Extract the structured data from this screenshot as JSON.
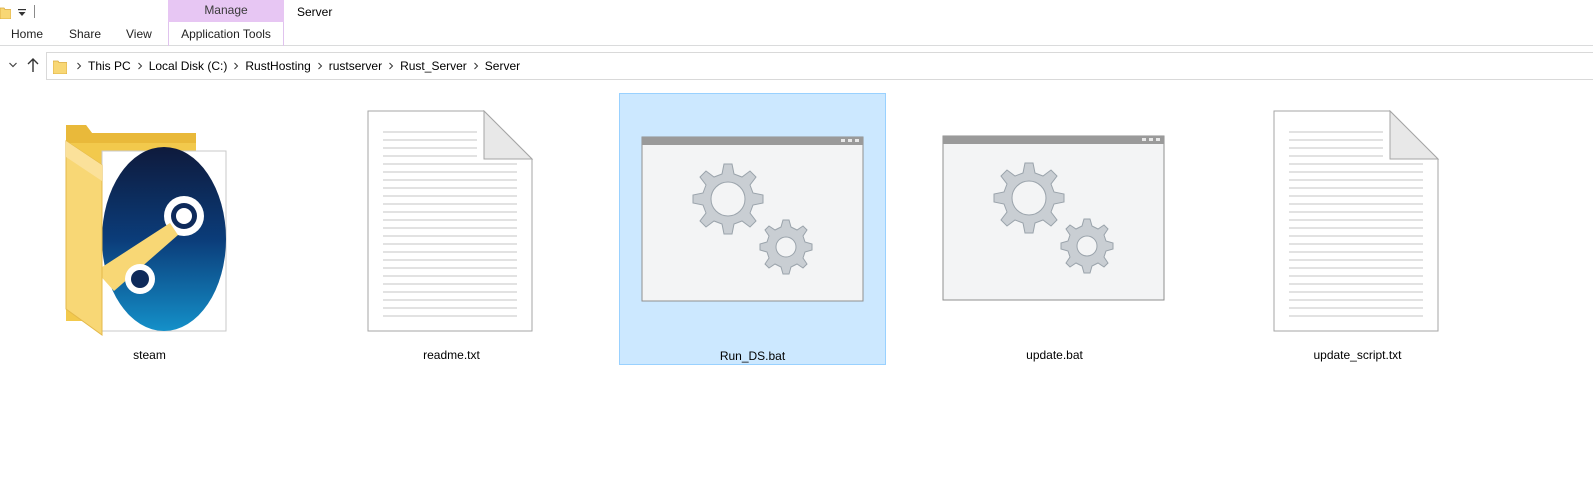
{
  "quick_access": {
    "folder_icon": "folder-icon",
    "dropdown_icon": "chevron-down-icon"
  },
  "title_bar": {
    "contextual_group": "Manage",
    "window_title": "Server"
  },
  "ribbon": {
    "tabs": [
      {
        "label": "Home"
      },
      {
        "label": "Share"
      },
      {
        "label": "View"
      },
      {
        "label": "Application Tools"
      }
    ]
  },
  "navigation": {
    "breadcrumbs": [
      "This PC",
      "Local Disk (C:)",
      "RustHosting",
      "rustserver",
      "Rust_Server",
      "Server"
    ]
  },
  "files": [
    {
      "name": "steam",
      "kind": "folder",
      "icon": "steam-folder-icon",
      "selected": false
    },
    {
      "name": "readme.txt",
      "kind": "text",
      "icon": "text-document-icon",
      "selected": false
    },
    {
      "name": "Run_DS.bat",
      "kind": "batch",
      "icon": "batch-file-icon",
      "selected": true
    },
    {
      "name": "update.bat",
      "kind": "batch",
      "icon": "batch-file-icon",
      "selected": false
    },
    {
      "name": "update_script.txt",
      "kind": "text",
      "icon": "text-document-icon",
      "selected": false
    }
  ],
  "colors": {
    "selection_fill": "#cce8ff",
    "selection_border": "#99d1ff",
    "manage_tab": "#e7c6f3",
    "folder_yellow": "#f8d775"
  }
}
